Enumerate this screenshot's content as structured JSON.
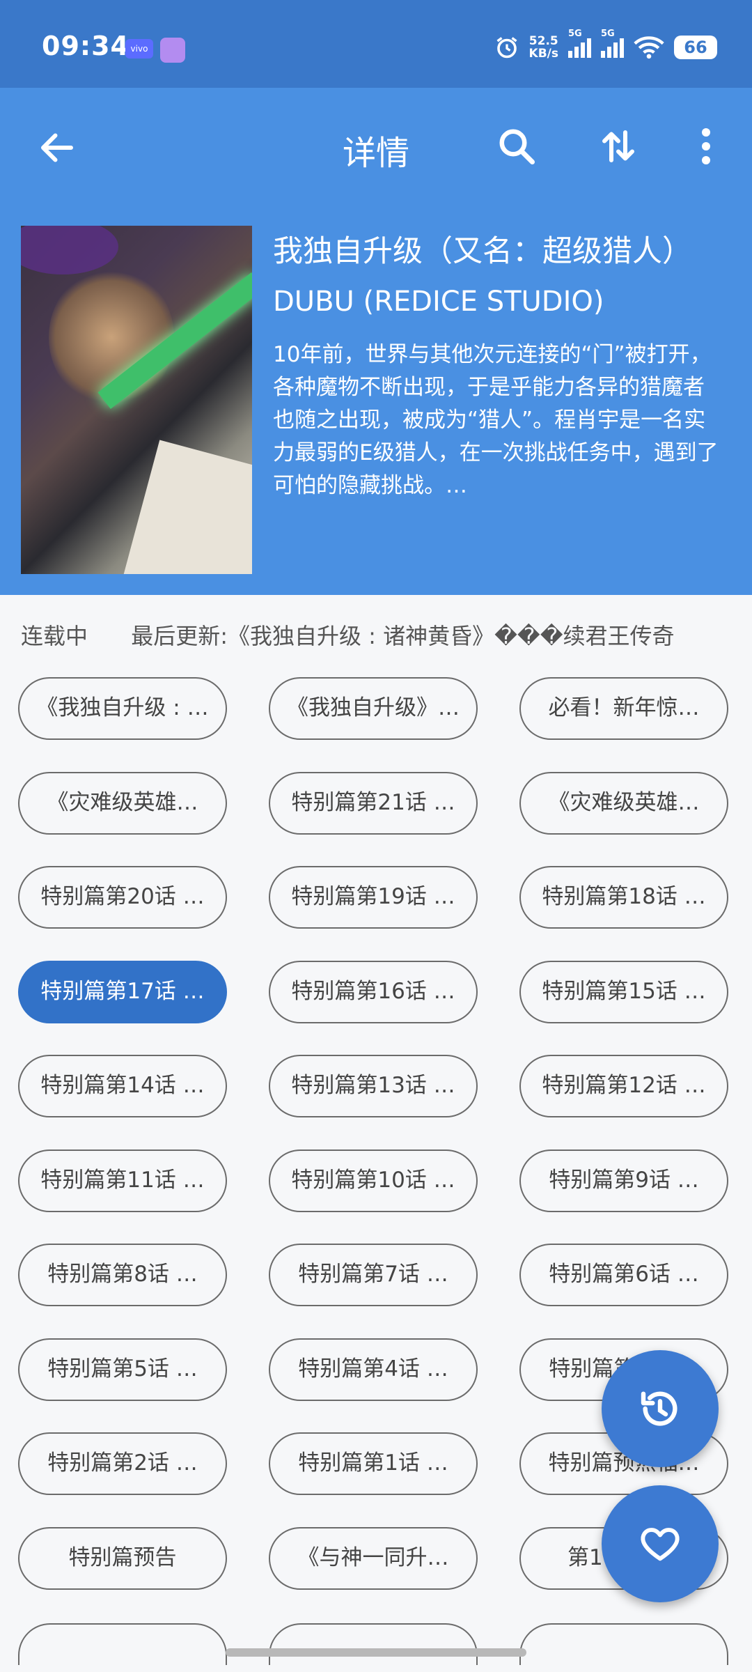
{
  "status": {
    "time": "09:34",
    "brand": "vivo",
    "speed_value": "52.5",
    "speed_unit": "KB/s",
    "net1": "5G",
    "net2": "5G",
    "battery": "66"
  },
  "toolbar": {
    "title": "详情",
    "icons": [
      "arrow-back-icon",
      "search-icon",
      "sort-icon",
      "more-vert-icon"
    ]
  },
  "book": {
    "title": "我独自升级（又名：超级猎人）",
    "author": "DUBU (REDICE STUDIO)",
    "description": "10年前，世界与其他次元连接的“门”被打开，各种魔物不断出现，于是乎能力各异的猎魔者也随之出现，被成为“猎人”。程肖宇是一名实力最弱的E级猎人，在一次挑战任务中，遇到了可怕的隐藏挑战。…"
  },
  "info": {
    "state": "连载中",
    "last_update": "最后更新:《我独自升级 : 诸神黄昏》���续君王传奇"
  },
  "chapters": [
    "《我独自升级 : …",
    "《我独自升级》…",
    "必看！新年惊…",
    "《灾难级英雄…",
    "特别篇第21话 …",
    "《灾难级英雄…",
    "特别篇第20话 …",
    "特别篇第19话 …",
    "特别篇第18话 …",
    "特别篇第17话 …",
    "特别篇第16话 …",
    "特别篇第15话 …",
    "特别篇第14话 …",
    "特别篇第13话 …",
    "特别篇第12话 …",
    "特别篇第11话 …",
    "特别篇第10话 …",
    "特别篇第9话 …",
    "特别篇第8话 …",
    "特别篇第7话 …",
    "特别篇第6话 …",
    "特别篇第5话 …",
    "特别篇第4话 …",
    "特别篇第3话 …",
    "特别篇第2话 …",
    "特别篇第1话 …",
    "特别篇预热福…",
    "特别篇预告",
    "《与神一同升…",
    "第179话 …"
  ],
  "active_chapter": "特别篇第17话 …",
  "fabs": [
    "history-icon",
    "favorite-heart-icon"
  ],
  "colors": {
    "status_bar": "#3a78c9",
    "header": "#4a90e2",
    "active_chip": "#3272c8",
    "fab": "#3d7ad2"
  }
}
